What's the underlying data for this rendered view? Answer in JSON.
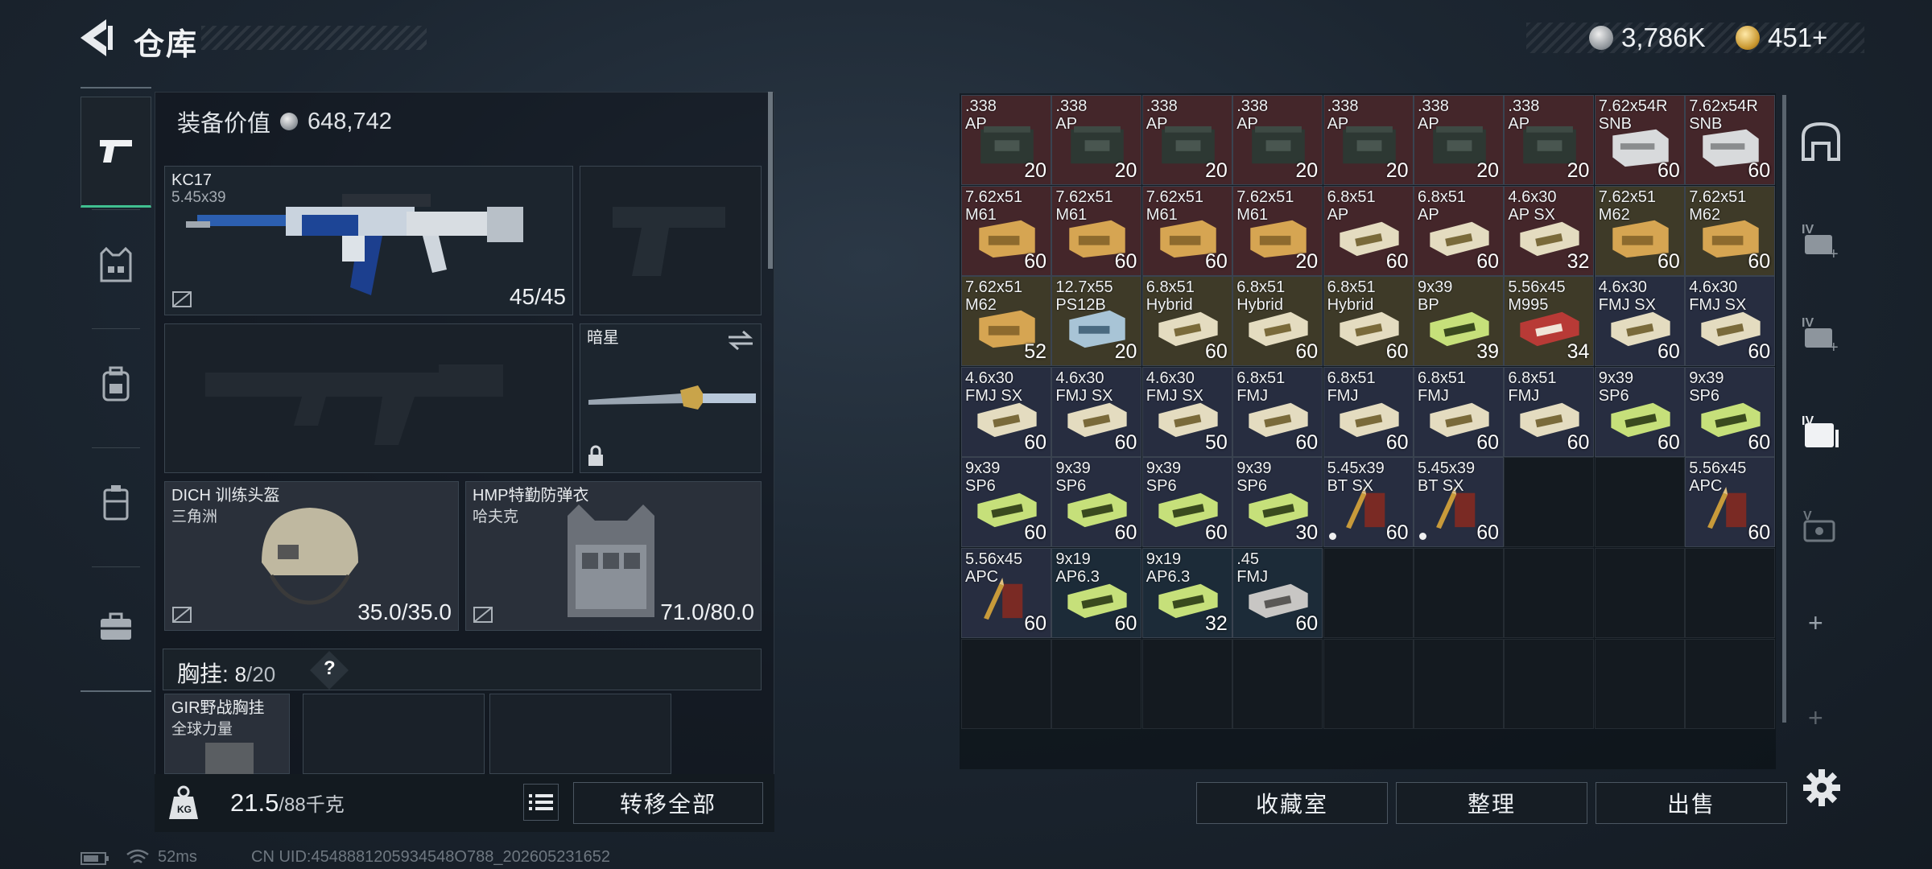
{
  "header": {
    "title": "仓库",
    "currency_silver": "3,786K",
    "currency_gold": "451+"
  },
  "left_nav": [
    "weapon-tab",
    "armor-tab",
    "backpack-tab",
    "chest-rig-tab",
    "case-tab"
  ],
  "loadout": {
    "worth_label": "装备价值",
    "worth_value": "648,742",
    "primary": {
      "name": "KC17",
      "caliber": "5.45x39",
      "ammo": "45/45"
    },
    "melee": {
      "name": "暗星"
    },
    "helmet": {
      "name": "DICH 训练头盔",
      "faction": "三角洲",
      "durability": "35.0/35.0"
    },
    "armor": {
      "name": "HMP特勤防弹衣",
      "faction": "哈夫克",
      "durability": "71.0/80.0"
    },
    "chest_rig_label": "胸挂:",
    "chest_rig_used": "8",
    "chest_rig_total": "/20",
    "chest_rig_help": "?",
    "rig_item": {
      "name": "GIR野战胸挂",
      "faction": "全球力量"
    },
    "weight": "21.5",
    "weight_max": "/88千克",
    "transfer_all": "转移全部"
  },
  "inventory": {
    "items": [
      {
        "name": ".338\nAP",
        "qty": "20",
        "color": "red",
        "box": "ammo-can"
      },
      {
        "name": ".338\nAP",
        "qty": "20",
        "color": "red",
        "box": "ammo-can"
      },
      {
        "name": ".338\nAP",
        "qty": "20",
        "color": "red",
        "box": "ammo-can"
      },
      {
        "name": ".338\nAP",
        "qty": "20",
        "color": "red",
        "box": "ammo-can"
      },
      {
        "name": ".338\nAP",
        "qty": "20",
        "color": "red",
        "box": "ammo-can"
      },
      {
        "name": ".338\nAP",
        "qty": "20",
        "color": "red",
        "box": "ammo-can"
      },
      {
        "name": ".338\nAP",
        "qty": "20",
        "color": "red",
        "box": "ammo-can"
      },
      {
        "name": "7.62x54R\nSNB",
        "qty": "60",
        "color": "red",
        "box": "white-box"
      },
      {
        "name": "7.62x54R\nSNB",
        "qty": "60",
        "color": "red",
        "box": "white-box"
      },
      {
        "name": "7.62x51\nM61",
        "qty": "60",
        "color": "red",
        "box": "gold-box"
      },
      {
        "name": "7.62x51\nM61",
        "qty": "60",
        "color": "red",
        "box": "gold-box"
      },
      {
        "name": "7.62x51\nM61",
        "qty": "60",
        "color": "red",
        "box": "gold-box"
      },
      {
        "name": "7.62x51\nM61",
        "qty": "20",
        "color": "red",
        "box": "gold-box"
      },
      {
        "name": "6.8x51\nAP",
        "qty": "60",
        "color": "red",
        "box": "beige-box"
      },
      {
        "name": "6.8x51\nAP",
        "qty": "60",
        "color": "red",
        "box": "beige-box"
      },
      {
        "name": "4.6x30\nAP SX",
        "qty": "32",
        "color": "red",
        "box": "beige-box"
      },
      {
        "name": "7.62x51\nM62",
        "qty": "60",
        "color": "olive",
        "box": "gold-box"
      },
      {
        "name": "7.62x51\nM62",
        "qty": "60",
        "color": "olive",
        "box": "gold-box"
      },
      {
        "name": "7.62x51\nM62",
        "qty": "52",
        "color": "olive",
        "box": "gold-box"
      },
      {
        "name": "12.7x55\nPS12B",
        "qty": "20",
        "color": "olive",
        "box": "blue-box"
      },
      {
        "name": "6.8x51\nHybrid",
        "qty": "60",
        "color": "olive",
        "box": "beige-box"
      },
      {
        "name": "6.8x51\nHybrid",
        "qty": "60",
        "color": "olive",
        "box": "beige-box"
      },
      {
        "name": "6.8x51\nHybrid",
        "qty": "60",
        "color": "olive",
        "box": "beige-box"
      },
      {
        "name": "9x39\nBP",
        "qty": "39",
        "color": "olive",
        "box": "green-box"
      },
      {
        "name": "5.56x45\nM995",
        "qty": "34",
        "color": "olive",
        "box": "red-box"
      },
      {
        "name": "4.6x30\nFMJ SX",
        "qty": "60",
        "color": "navy",
        "box": "beige-box"
      },
      {
        "name": "4.6x30\nFMJ SX",
        "qty": "60",
        "color": "navy",
        "box": "beige-box"
      },
      {
        "name": "4.6x30\nFMJ SX",
        "qty": "60",
        "color": "navy",
        "box": "beige-box"
      },
      {
        "name": "4.6x30\nFMJ SX",
        "qty": "60",
        "color": "navy",
        "box": "beige-box"
      },
      {
        "name": "4.6x30\nFMJ SX",
        "qty": "50",
        "color": "navy",
        "box": "beige-box"
      },
      {
        "name": "6.8x51\nFMJ",
        "qty": "60",
        "color": "navy",
        "box": "beige-box"
      },
      {
        "name": "6.8x51\nFMJ",
        "qty": "60",
        "color": "navy",
        "box": "beige-box"
      },
      {
        "name": "6.8x51\nFMJ",
        "qty": "60",
        "color": "navy",
        "box": "beige-box"
      },
      {
        "name": "6.8x51\nFMJ",
        "qty": "60",
        "color": "navy",
        "box": "beige-box"
      },
      {
        "name": "9x39\nSP6",
        "qty": "60",
        "color": "navy",
        "box": "green-box"
      },
      {
        "name": "9x39\nSP6",
        "qty": "60",
        "color": "navy",
        "box": "green-box"
      },
      {
        "name": "9x39\nSP6",
        "qty": "60",
        "color": "navy",
        "box": "green-box"
      },
      {
        "name": "9x39\nSP6",
        "qty": "60",
        "color": "navy",
        "box": "green-box"
      },
      {
        "name": "9x39\nSP6",
        "qty": "60",
        "color": "navy",
        "box": "green-box"
      },
      {
        "name": "9x39\nSP6",
        "qty": "30",
        "color": "navy",
        "box": "green-box"
      },
      {
        "name": "5.45x39\nBT SX",
        "qty": "60",
        "color": "navy",
        "box": "rounds",
        "dot": true
      },
      {
        "name": "5.45x39\nBT SX",
        "qty": "60",
        "color": "navy",
        "box": "rounds",
        "dot": true
      },
      null,
      null,
      {
        "name": "5.56x45\nAPC",
        "qty": "60",
        "color": "navy",
        "box": "rounds"
      },
      {
        "name": "5.56x45\nAPC",
        "qty": "60",
        "color": "navy",
        "box": "rounds"
      },
      {
        "name": "9x19\nAP6.3",
        "qty": "60",
        "color": "teal",
        "box": "green-box"
      },
      {
        "name": "9x19\nAP6.3",
        "qty": "32",
        "color": "teal",
        "box": "green-box"
      },
      {
        "name": ".45\nFMJ",
        "qty": "60",
        "color": "teal",
        "box": "gray-box"
      }
    ],
    "total_cells": 63
  },
  "bottom_buttons": {
    "collection": "收藏室",
    "sort": "整理",
    "sell": "出售"
  },
  "status_bar": {
    "ping": "52ms",
    "uid": "CN UID:4548881205934548O788_202605231652"
  },
  "colors": {
    "accent_green": "#40c090",
    "cell_red": "#44262a",
    "cell_olive": "#3e3a28",
    "cell_navy": "#272d40"
  }
}
